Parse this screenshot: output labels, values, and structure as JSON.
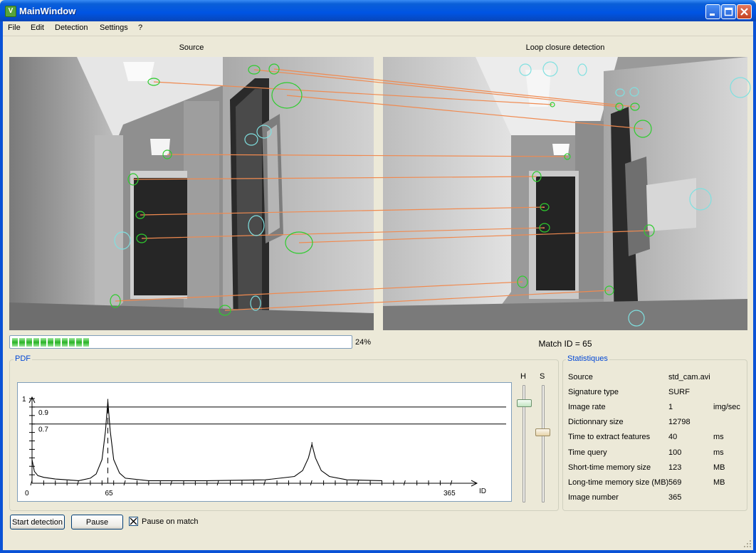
{
  "window": {
    "title": "MainWindow",
    "app_icon_glyph": "V"
  },
  "menu": [
    "File",
    "Edit",
    "Detection",
    "Settings",
    "?"
  ],
  "source_panel": {
    "caption": "Source"
  },
  "loop_panel": {
    "caption": "Loop closure detection",
    "match_text": "Match ID = 65"
  },
  "progress": {
    "value": 0.24,
    "label": "24%"
  },
  "pdf": {
    "group_title": "PDF",
    "slider_h_label": "H",
    "slider_s_label": "S",
    "slider_h_level": 0.97,
    "slider_s_level": 0.63
  },
  "chart_data": {
    "type": "line",
    "x_tick_labels": [
      "0",
      "65",
      "365"
    ],
    "xlabel": "ID",
    "y_tick_labels": [
      "1",
      "0.9",
      "0.7"
    ],
    "xlim": [
      0,
      365
    ],
    "ylim": [
      0,
      1
    ],
    "thresholds": [
      0.9,
      0.7
    ],
    "marker_x": 65,
    "peaks": [
      {
        "x": 65,
        "y": 0.97
      },
      {
        "x": 240,
        "y": 0.46
      }
    ],
    "series": [
      {
        "values": [
          [
            0,
            0.28
          ],
          [
            2,
            0.14
          ],
          [
            5,
            0.09
          ],
          [
            10,
            0.07
          ],
          [
            20,
            0.05
          ],
          [
            30,
            0.04
          ],
          [
            40,
            0.03
          ],
          [
            50,
            0.06
          ],
          [
            55,
            0.11
          ],
          [
            60,
            0.28
          ],
          [
            63,
            0.62
          ],
          [
            65,
            0.97
          ],
          [
            67,
            0.62
          ],
          [
            70,
            0.28
          ],
          [
            75,
            0.12
          ],
          [
            80,
            0.06
          ],
          [
            100,
            0.03
          ],
          [
            150,
            0.03
          ],
          [
            200,
            0.04
          ],
          [
            225,
            0.08
          ],
          [
            232,
            0.15
          ],
          [
            237,
            0.3
          ],
          [
            240,
            0.46
          ],
          [
            243,
            0.3
          ],
          [
            248,
            0.15
          ],
          [
            255,
            0.08
          ],
          [
            270,
            0.04
          ],
          [
            300,
            0.03
          ]
        ]
      }
    ]
  },
  "statistics": {
    "title": "Statistiques",
    "rows": [
      {
        "label": "Source",
        "value": "std_cam.avi",
        "unit": ""
      },
      {
        "label": "Signature type",
        "value": "SURF",
        "unit": ""
      },
      {
        "label": "Image rate",
        "value": "1",
        "unit": "img/sec"
      },
      {
        "label": "Dictionnary size",
        "value": "12798",
        "unit": ""
      },
      {
        "label": "Time to extract features",
        "value": "40",
        "unit": "ms"
      },
      {
        "label": "Time query",
        "value": "100",
        "unit": "ms"
      },
      {
        "label": "Short-time memory size",
        "value": "123",
        "unit": "MB"
      },
      {
        "label": "Long-time memory size (MB)",
        "value": "569",
        "unit": "MB"
      },
      {
        "label": "Image number",
        "value": "365",
        "unit": ""
      }
    ]
  },
  "controls": {
    "start_label": "Start detection",
    "pause_label": "Pause",
    "pause_on_match_label": "Pause on match",
    "pause_on_match_checked": true
  },
  "colors": {
    "feature_match": "#2ecc2e",
    "feature_unmatched": "#7fe0e0",
    "match_line": "#f08a50",
    "group_title": "#0046d5"
  }
}
